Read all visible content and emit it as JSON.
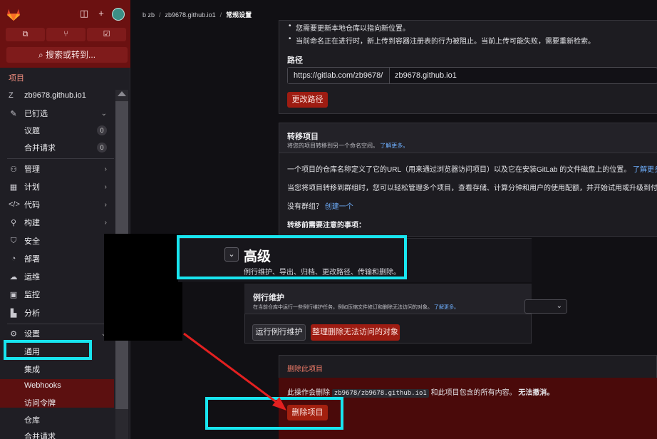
{
  "breadcrumb": {
    "group": "b zb",
    "project": "zb9678.github.io1",
    "current": "常规设置"
  },
  "sidebar": {
    "search_label": "搜索或转到...",
    "section_title": "项目",
    "project_initial": "Z",
    "project_name": "zb9678.github.io1",
    "pinned": {
      "label": "已钉选",
      "items": [
        {
          "label": "议题",
          "count": "0"
        },
        {
          "label": "合并请求",
          "count": "0"
        }
      ]
    },
    "items": [
      {
        "label": "管理"
      },
      {
        "label": "计划"
      },
      {
        "label": "代码"
      },
      {
        "label": "构建"
      },
      {
        "label": "安全"
      },
      {
        "label": "部署"
      },
      {
        "label": "运维"
      },
      {
        "label": "监控"
      },
      {
        "label": "分析"
      }
    ],
    "settings": {
      "label": "设置",
      "children": [
        "通用",
        "集成",
        "Webhooks",
        "访问令牌",
        "仓库",
        "合并请求"
      ]
    }
  },
  "rename": {
    "bullet1": "您需要更新本地仓库以指向新位置。",
    "bullet2": "当前命名正在进行时，新上传到容器注册表的行为被阻止。当前上传可能失败，需要重新检索。",
    "path_label": "路径",
    "path_prefix": "https://gitlab.com/zb9678/",
    "path_value": "zb9678.github.io1",
    "button": "更改路径"
  },
  "transfer": {
    "title": "转移项目",
    "subtitle": "将您的项目转移到另一个命名空间。",
    "learn_more": "了解更多。",
    "para1": "一个项目的仓库名称定义了它的URL（用来通过浏览器访问项目）以及它在安装GitLab 的文件磁盘上的位置。",
    "para1_link": "了解更多",
    "para2": "当您将项目转移到群组时，您可以轻松管理多个项目，查看存储、计算分钟和用户的使用配额，并开始试用或升级到付费",
    "para3": "没有群组？",
    "para3_link": "创建一个",
    "notes_title": "转移前需要注意的事项："
  },
  "advanced": {
    "title": "高级",
    "description": "例行维护、导出、归档、更改路径、传输和删除。"
  },
  "maintenance": {
    "title": "例行维护",
    "description": "在当前仓库中运行一些例行维护任务，例如压缩文件修订和删除无法访问的对象。",
    "learn_more": "了解更多。",
    "run_button": "运行例行维护",
    "prune_button": "整理删除无法访问的对象"
  },
  "delete": {
    "title": "删除此项目",
    "text_before": "此操作会删除",
    "code": "zb9678/zb9678.github.io1",
    "text_after": "和此项目包含的所有内容。",
    "warning": "无法撤消。",
    "button": "删除项目"
  },
  "colors": {
    "annotation": "#18e5ef",
    "arrow": "#e32020",
    "danger": "#9e1c12"
  }
}
